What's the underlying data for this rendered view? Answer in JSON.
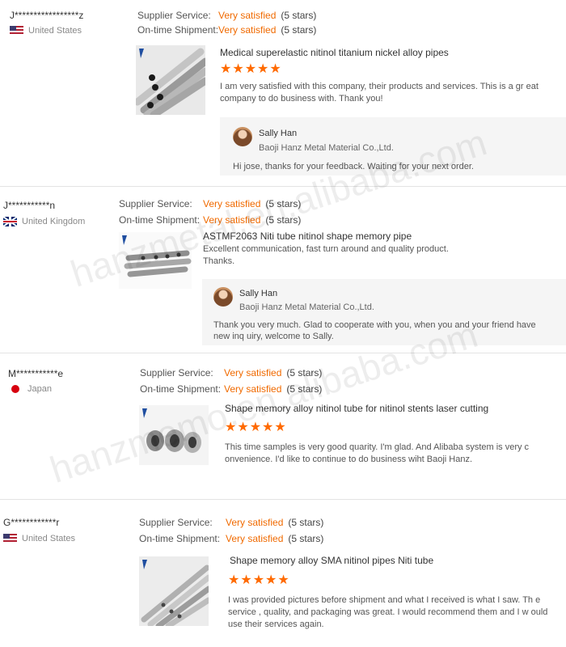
{
  "accent_color": "#f06a00",
  "labels": {
    "supplier_service": "Supplier Service:",
    "ontime_shipment": "On-time Shipment:"
  },
  "watermarks": [
    "hanzmetal.en.alibaba.com",
    "hanzmemo.en.alibaba.com"
  ],
  "reviews": [
    {
      "buyer": "J*****************z",
      "country": "United States",
      "flag": "us-flag-icon",
      "supplier_service": "Very satisfied",
      "supplier_stars": "(5 stars)",
      "shipment": "Very satisfied",
      "shipment_stars": "(5 stars)",
      "product": "Medical superelastic nitinol titanium nickel alloy pipes",
      "rating": 5,
      "stars": "★★★★★",
      "comment": "I am very satisfied with this company, their products and services. This is a gr eat company to do business with. Thank you!",
      "reply": {
        "name": "Sally Han",
        "company": "Baoji Hanz Metal Material Co.,Ltd.",
        "text": "Hi jose, thanks for your feedback. Waiting for your next order."
      }
    },
    {
      "buyer": "J***********n",
      "country": "United Kingdom",
      "flag": "uk-flag-icon",
      "supplier_service": "Very satisfied",
      "supplier_stars": "(5 stars)",
      "shipment": "Very satisfied",
      "shipment_stars": "(5 stars)",
      "product": "ASTMF2063 Niti tube nitinol shape memory pipe",
      "comment": "Excellent communication, fast turn around and quality product. Thanks.",
      "reply": {
        "name": "Sally Han",
        "company": "Baoji Hanz Metal Material Co.,Ltd.",
        "text": "Thank you very much. Glad to cooperate with you, when you and your friend have new inq uiry, welcome to Sally."
      }
    },
    {
      "buyer": "M***********e",
      "country": "Japan",
      "flag": "japan-flag-icon",
      "supplier_service": "Very satisfied",
      "supplier_stars": "(5 stars)",
      "shipment": "Very satisfied",
      "shipment_stars": "(5 stars)",
      "product": "Shape memory alloy nitinol tube for nitinol stents laser cutting",
      "rating": 5,
      "stars": "★★★★★",
      "comment": "This time samples is very good quarity. I'm glad. And Alibaba system is very c onvenience. I'd like to continue to do business wiht Baoji Hanz."
    },
    {
      "buyer": "G************r",
      "country": "United States",
      "flag": "us-flag-icon",
      "supplier_service": "Very satisfied",
      "supplier_stars": "(5 stars)",
      "shipment": "Very satisfied",
      "shipment_stars": "(5 stars)",
      "product": "Shape memory alloy SMA nitinol pipes Niti tube",
      "rating": 5,
      "stars": "★★★★★",
      "comment": "I was provided pictures before shipment and what I received is what I saw. Th e service , quality, and packaging was great. I would recommend them and I w ould use their services again."
    }
  ]
}
